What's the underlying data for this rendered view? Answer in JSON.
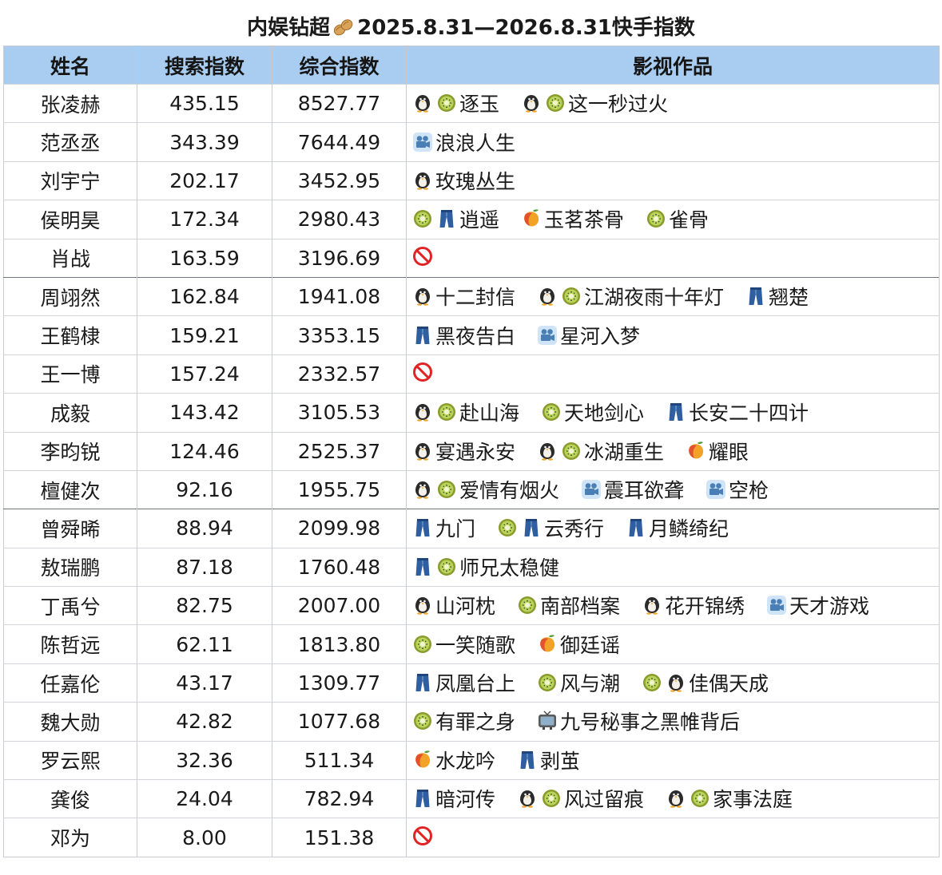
{
  "title": {
    "prefix": "内娱钻超",
    "suffix": "2025.8.31—2026.8.31快手指数",
    "emoji": "peanut-icon"
  },
  "headers": [
    "姓名",
    "搜索指数",
    "综合指数",
    "影视作品"
  ],
  "platform_icons": {
    "penguin": "Tencent Video (penguin-icon)",
    "kiwi": "iQIYI (kiwi-icon)",
    "jeans": "Youku (jeans-icon)",
    "mango": "Mango TV (mango-icon)",
    "camera": "Cinema film (movie-camera-icon)",
    "tv": "TV broadcast (television-icon)",
    "none": "No works (prohibited-icon)"
  },
  "colors": {
    "header_bg": "#a9cdf0",
    "row_border": "#d2d5da",
    "group_separator": "#6f747b",
    "prohibited_red": "#e02424"
  },
  "rows": [
    {
      "name": "张凌赫",
      "search": "435.15",
      "overall": "8527.77",
      "works": [
        {
          "icons": [
            "penguin",
            "kiwi"
          ],
          "title": "逐玉"
        },
        {
          "icons": [
            "penguin",
            "kiwi"
          ],
          "title": "这一秒过火"
        }
      ]
    },
    {
      "name": "范丞丞",
      "search": "343.39",
      "overall": "7644.49",
      "works": [
        {
          "icons": [
            "camera"
          ],
          "title": "浪浪人生"
        }
      ]
    },
    {
      "name": "刘宇宁",
      "search": "202.17",
      "overall": "3452.95",
      "works": [
        {
          "icons": [
            "penguin"
          ],
          "title": "玫瑰丛生"
        }
      ]
    },
    {
      "name": "侯明昊",
      "search": "172.34",
      "overall": "2980.43",
      "works": [
        {
          "icons": [
            "kiwi",
            "jeans"
          ],
          "title": "逍遥"
        },
        {
          "icons": [
            "mango"
          ],
          "title": "玉茗茶骨"
        },
        {
          "icons": [
            "kiwi"
          ],
          "title": "雀骨"
        }
      ]
    },
    {
      "name": "肖战",
      "search": "163.59",
      "overall": "3196.69",
      "works": [
        {
          "icons": [
            "none"
          ],
          "title": ""
        }
      ]
    },
    {
      "name": "周翊然",
      "search": "162.84",
      "overall": "1941.08",
      "works": [
        {
          "icons": [
            "penguin"
          ],
          "title": "十二封信"
        },
        {
          "icons": [
            "penguin",
            "kiwi"
          ],
          "title": "江湖夜雨十年灯"
        },
        {
          "icons": [
            "jeans"
          ],
          "title": "翘楚"
        }
      ],
      "separator": true
    },
    {
      "name": "王鹤棣",
      "search": "159.21",
      "overall": "3353.15",
      "works": [
        {
          "icons": [
            "jeans"
          ],
          "title": "黑夜告白"
        },
        {
          "icons": [
            "camera"
          ],
          "title": "星河入梦"
        }
      ]
    },
    {
      "name": "王一博",
      "search": "157.24",
      "overall": "2332.57",
      "works": [
        {
          "icons": [
            "none"
          ],
          "title": ""
        }
      ]
    },
    {
      "name": "成毅",
      "search": "143.42",
      "overall": "3105.53",
      "works": [
        {
          "icons": [
            "penguin",
            "kiwi"
          ],
          "title": "赴山海"
        },
        {
          "icons": [
            "kiwi"
          ],
          "title": "天地剑心"
        },
        {
          "icons": [
            "jeans"
          ],
          "title": "长安二十四计"
        }
      ]
    },
    {
      "name": "李昀锐",
      "search": "124.46",
      "overall": "2525.37",
      "works": [
        {
          "icons": [
            "penguin"
          ],
          "title": "宴遇永安"
        },
        {
          "icons": [
            "penguin",
            "kiwi"
          ],
          "title": "冰湖重生"
        },
        {
          "icons": [
            "mango"
          ],
          "title": "耀眼"
        }
      ]
    },
    {
      "name": "檀健次",
      "search": "92.16",
      "overall": "1955.75",
      "works": [
        {
          "icons": [
            "penguin",
            "kiwi"
          ],
          "title": "爱情有烟火"
        },
        {
          "icons": [
            "camera"
          ],
          "title": "震耳欲聋"
        },
        {
          "icons": [
            "camera"
          ],
          "title": "空枪"
        }
      ]
    },
    {
      "name": "曾舜晞",
      "search": "88.94",
      "overall": "2099.98",
      "works": [
        {
          "icons": [
            "jeans"
          ],
          "title": "九门"
        },
        {
          "icons": [
            "kiwi",
            "jeans"
          ],
          "title": "云秀行"
        },
        {
          "icons": [
            "jeans"
          ],
          "title": "月鳞绮纪"
        }
      ],
      "separator": true
    },
    {
      "name": "敖瑞鹏",
      "search": "87.18",
      "overall": "1760.48",
      "works": [
        {
          "icons": [
            "jeans",
            "kiwi"
          ],
          "title": "师兄太稳健"
        }
      ]
    },
    {
      "name": "丁禹兮",
      "search": "82.75",
      "overall": "2007.00",
      "works": [
        {
          "icons": [
            "penguin"
          ],
          "title": "山河枕"
        },
        {
          "icons": [
            "kiwi"
          ],
          "title": "南部档案"
        },
        {
          "icons": [
            "penguin"
          ],
          "title": "花开锦绣"
        },
        {
          "icons": [
            "camera"
          ],
          "title": "天才游戏"
        }
      ]
    },
    {
      "name": "陈哲远",
      "search": "62.11",
      "overall": "1813.80",
      "works": [
        {
          "icons": [
            "kiwi"
          ],
          "title": "一笑随歌"
        },
        {
          "icons": [
            "mango"
          ],
          "title": "御廷谣"
        }
      ]
    },
    {
      "name": "任嘉伦",
      "search": "43.17",
      "overall": "1309.77",
      "works": [
        {
          "icons": [
            "jeans"
          ],
          "title": "凤凰台上"
        },
        {
          "icons": [
            "kiwi"
          ],
          "title": "风与潮"
        },
        {
          "icons": [
            "kiwi",
            "penguin"
          ],
          "title": "佳偶天成"
        }
      ]
    },
    {
      "name": "魏大勋",
      "search": "42.82",
      "overall": "1077.68",
      "works": [
        {
          "icons": [
            "kiwi"
          ],
          "title": "有罪之身"
        },
        {
          "icons": [
            "tv"
          ],
          "title": "九号秘事之黑帷背后"
        }
      ]
    },
    {
      "name": "罗云熙",
      "search": "32.36",
      "overall": "511.34",
      "works": [
        {
          "icons": [
            "mango"
          ],
          "title": "水龙吟"
        },
        {
          "icons": [
            "jeans"
          ],
          "title": "剥茧"
        }
      ]
    },
    {
      "name": "龚俊",
      "search": "24.04",
      "overall": "782.94",
      "works": [
        {
          "icons": [
            "jeans"
          ],
          "title": "暗河传"
        },
        {
          "icons": [
            "penguin",
            "kiwi"
          ],
          "title": "风过留痕"
        },
        {
          "icons": [
            "penguin",
            "kiwi"
          ],
          "title": "家事法庭"
        }
      ]
    },
    {
      "name": "邓为",
      "search": "8.00",
      "overall": "151.38",
      "works": [
        {
          "icons": [
            "none"
          ],
          "title": ""
        }
      ]
    }
  ]
}
